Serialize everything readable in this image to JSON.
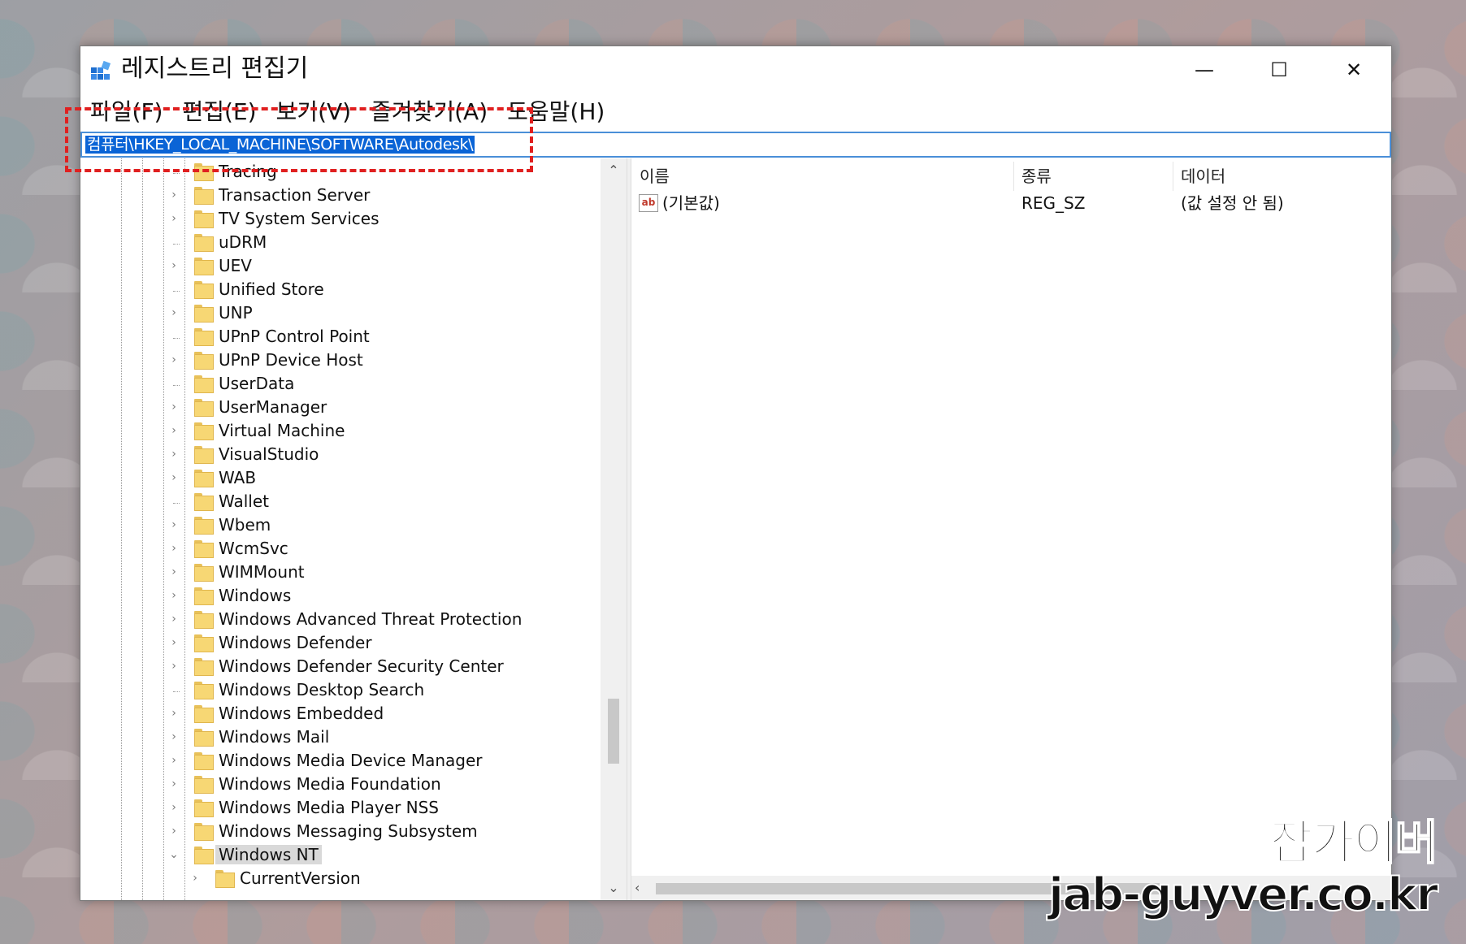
{
  "window": {
    "title": "레지스트리 편집기",
    "minimize": "—",
    "maximize": "☐",
    "close": "✕"
  },
  "menu": [
    "파일(F)",
    "편집(E)",
    "보기(V)",
    "즐겨찾기(A)",
    "도움말(H)"
  ],
  "address": "컴퓨터\\HKEY_LOCAL_MACHINE\\SOFTWARE\\Autodesk\\",
  "tree": [
    {
      "label": "Tracing",
      "expander": ""
    },
    {
      "label": "Transaction Server",
      "expander": "›"
    },
    {
      "label": "TV System Services",
      "expander": "›"
    },
    {
      "label": "uDRM",
      "expander": ""
    },
    {
      "label": "UEV",
      "expander": "›"
    },
    {
      "label": "Unified Store",
      "expander": ""
    },
    {
      "label": "UNP",
      "expander": "›"
    },
    {
      "label": "UPnP Control Point",
      "expander": ""
    },
    {
      "label": "UPnP Device Host",
      "expander": "›"
    },
    {
      "label": "UserData",
      "expander": ""
    },
    {
      "label": "UserManager",
      "expander": "›"
    },
    {
      "label": "Virtual Machine",
      "expander": "›"
    },
    {
      "label": "VisualStudio",
      "expander": "›"
    },
    {
      "label": "WAB",
      "expander": "›"
    },
    {
      "label": "Wallet",
      "expander": ""
    },
    {
      "label": "Wbem",
      "expander": "›"
    },
    {
      "label": "WcmSvc",
      "expander": "›"
    },
    {
      "label": "WIMMount",
      "expander": "›"
    },
    {
      "label": "Windows",
      "expander": "›"
    },
    {
      "label": "Windows Advanced Threat Protection",
      "expander": "›"
    },
    {
      "label": "Windows Defender",
      "expander": "›"
    },
    {
      "label": "Windows Defender Security Center",
      "expander": "›"
    },
    {
      "label": "Windows Desktop Search",
      "expander": ""
    },
    {
      "label": "Windows Embedded",
      "expander": "›"
    },
    {
      "label": "Windows Mail",
      "expander": "›"
    },
    {
      "label": "Windows Media Device Manager",
      "expander": "›"
    },
    {
      "label": "Windows Media Foundation",
      "expander": "›"
    },
    {
      "label": "Windows Media Player NSS",
      "expander": "›"
    },
    {
      "label": "Windows Messaging Subsystem",
      "expander": "›"
    },
    {
      "label": "Windows NT",
      "expander": "⌄",
      "selected": true
    },
    {
      "label": "CurrentVersion",
      "expander": "›",
      "child": true
    }
  ],
  "list": {
    "columns": [
      "이름",
      "종류",
      "데이터"
    ],
    "rows": [
      {
        "icon": "ab",
        "name": "(기본값)",
        "type": "REG_SZ",
        "data": "(값 설정 안 됨)"
      }
    ]
  },
  "scroll": {
    "up": "⌃",
    "down": "⌄",
    "left": "‹"
  },
  "watermark": {
    "name": "잡가이버",
    "url": "jab-guyver.co.kr"
  },
  "colors": {
    "accent": "#0a64d6",
    "highlight_box": "#e02020",
    "folder": "#f7d774"
  }
}
